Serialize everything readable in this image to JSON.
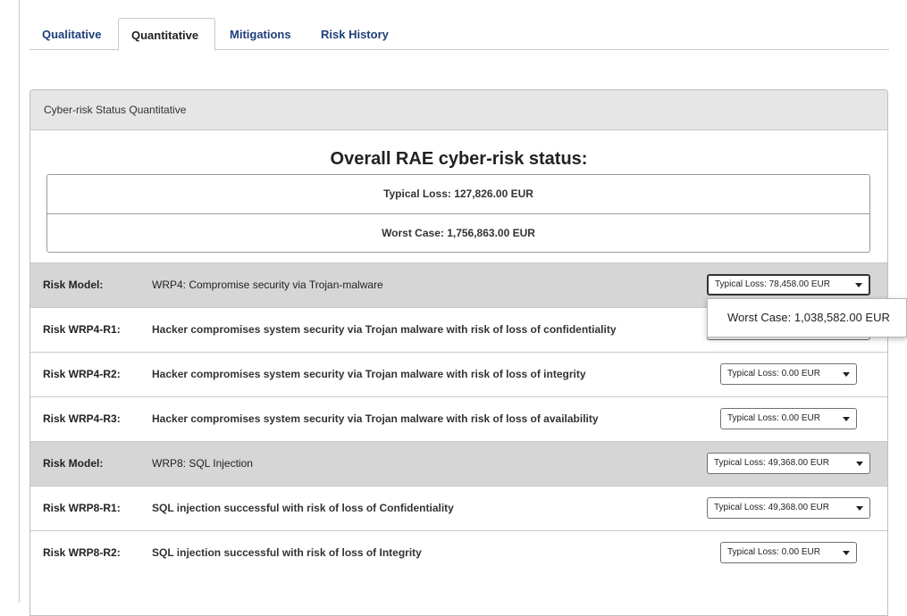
{
  "tabs": [
    "Qualitative",
    "Quantitative",
    "Mitigations",
    "Risk History"
  ],
  "active_tab": "Quantitative",
  "panel": {
    "heading": "Cyber-risk Status Quantitative",
    "overall_title": "Overall RAE cyber-risk status:",
    "typical_loss": "Typical Loss: 127,826.00 EUR",
    "worst_case": "Worst Case: 1,756,863.00 EUR"
  },
  "risk_rows": [
    {
      "kind": "model",
      "id": "Risk Model:",
      "description": "WRP4: Compromise security via Trojan-malware",
      "value": "Typical Loss: 78,458.00 EUR"
    },
    {
      "kind": "risk",
      "id": "Risk WRP4-R1:",
      "description": "Hacker compromises system security via Trojan malware with risk of loss of confidentiality",
      "value": ""
    },
    {
      "kind": "risk",
      "id": "Risk WRP4-R2:",
      "description": "Hacker compromises system security via Trojan malware with risk of loss of integrity",
      "value": "Typical Loss: 0.00 EUR"
    },
    {
      "kind": "risk",
      "id": "Risk WRP4-R3:",
      "description": "Hacker compromises system security via Trojan malware with risk of loss of availability",
      "value": "Typical Loss: 0.00 EUR"
    },
    {
      "kind": "model",
      "id": "Risk Model:",
      "description": "WRP8: SQL Injection",
      "value": "Typical Loss: 49,368.00 EUR"
    },
    {
      "kind": "risk",
      "id": "Risk WRP8-R1:",
      "description": "SQL injection successful with risk of loss of Confidentiality",
      "value": "Typical Loss: 49,368.00 EUR"
    },
    {
      "kind": "risk",
      "id": "Risk WRP8-R2:",
      "description": "SQL injection successful with risk of loss of Integrity",
      "value": "Typical Loss: 0.00 EUR"
    }
  ],
  "open_dropdown_option": "Worst Case: 1,038,582.00 EUR",
  "icons": {
    "dropdown": "caret-down-icon"
  }
}
